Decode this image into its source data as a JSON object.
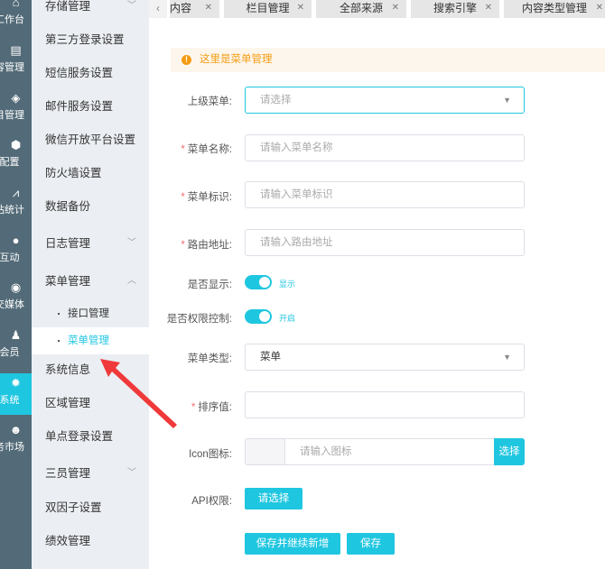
{
  "rail": [
    {
      "label": "工作台",
      "icon": "home-icon"
    },
    {
      "label": "容管理",
      "icon": "document-icon"
    },
    {
      "label": "目管理",
      "icon": "layers-icon"
    },
    {
      "label": "配置",
      "icon": "cube-icon"
    },
    {
      "label": "站统计",
      "icon": "chart-icon"
    },
    {
      "label": "互动",
      "icon": "chat-icon"
    },
    {
      "label": "交媒体",
      "icon": "media-icon"
    },
    {
      "label": "会员",
      "icon": "member-icon"
    },
    {
      "label": "系统",
      "icon": "gear-icon"
    },
    {
      "label": "务市场",
      "icon": "service-icon"
    }
  ],
  "submenu": [
    {
      "label": "存储管理"
    },
    {
      "label": "第三方登录设置"
    },
    {
      "label": "短信服务设置"
    },
    {
      "label": "邮件服务设置"
    },
    {
      "label": "微信开放平台设置"
    },
    {
      "label": "防火墙设置"
    },
    {
      "label": "数据备份"
    },
    {
      "label": "日志管理"
    },
    {
      "label": "菜单管理"
    },
    {
      "label": "接口管理"
    },
    {
      "label": "菜单管理"
    },
    {
      "label": "系统信息"
    },
    {
      "label": "区域管理"
    },
    {
      "label": "单点登录设置"
    },
    {
      "label": "三员管理"
    },
    {
      "label": "双因子设置"
    },
    {
      "label": "绩效管理"
    }
  ],
  "tabs": [
    {
      "label": "内容"
    },
    {
      "label": "栏目管理"
    },
    {
      "label": "全部来源"
    },
    {
      "label": "搜索引擎"
    },
    {
      "label": "内容类型管理"
    }
  ],
  "alert": "这里是菜单管理",
  "form": {
    "parent": {
      "label": "上级菜单:",
      "placeholder": "请选择"
    },
    "name": {
      "label": "菜单名称:",
      "placeholder": "请输入菜单名称"
    },
    "code": {
      "label": "菜单标识:",
      "placeholder": "请输入菜单标识"
    },
    "route": {
      "label": "路由地址:",
      "placeholder": "请输入路由地址"
    },
    "show": {
      "label": "是否显示:",
      "state": "显示"
    },
    "perm": {
      "label": "是否权限控制:",
      "state": "开启"
    },
    "type": {
      "label": "菜单类型:",
      "value": "菜单"
    },
    "sort": {
      "label": "排序值:",
      "value": ""
    },
    "icon": {
      "label": "Icon图标:",
      "placeholder": "请输入图标",
      "button": "选择"
    },
    "api": {
      "label": "API权限:",
      "button": "请选择"
    },
    "save_continue": "保存并继续新增",
    "save": "保存"
  },
  "colors": {
    "accent": "#1fc6e0",
    "rail": "#536b78",
    "warning": "#f39c12",
    "arrow": "#f0393a"
  }
}
